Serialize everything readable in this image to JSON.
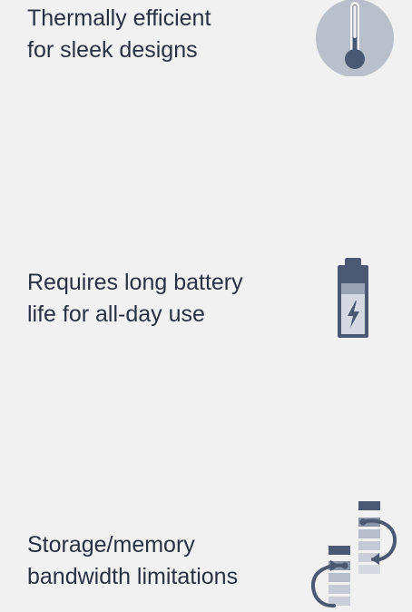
{
  "features": [
    {
      "lines": [
        "Thermally efficient",
        "for sleek designs"
      ],
      "icon": "thermometer-icon"
    },
    {
      "lines": [
        "Requires long battery",
        "life for all-day use"
      ],
      "icon": "battery-charging-icon"
    },
    {
      "lines": [
        "Storage/memory",
        "bandwidth limitations"
      ],
      "icon": "memory-transfer-icon"
    }
  ],
  "colors": {
    "background": "#f1f1f2",
    "text": "#2a3142",
    "icon_dark": "#4a5874",
    "icon_light": "#b7bdca",
    "icon_lighter": "#d5d9e1",
    "icon_circle": "#b9c0cc"
  }
}
